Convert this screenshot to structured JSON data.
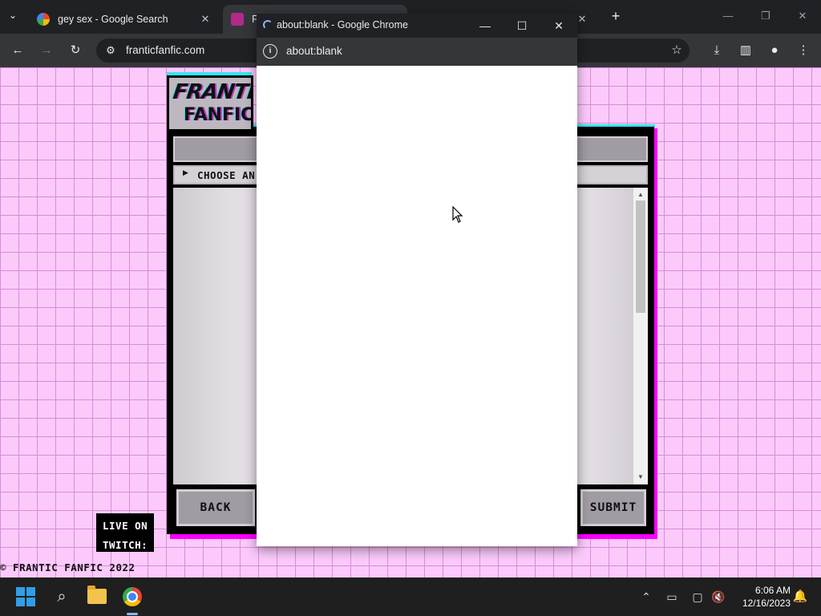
{
  "browser": {
    "tabs": [
      {
        "title": "gey sex - Google Search",
        "active": false
      },
      {
        "title": "Fr",
        "active": true
      },
      {
        "title": "",
        "active": false
      }
    ],
    "address": "franticfanfic.com"
  },
  "page": {
    "logo_line1": "FRANTIC",
    "logo_line2": "FANFIC",
    "choose_label": "CHOOSE AN",
    "back_label": "BACK",
    "submit_label": "SUBMIT",
    "live_line1": "LIVE ON",
    "live_line2": "TWITCH:",
    "copyright": "© FRANTIC FANFIC 2022"
  },
  "popup": {
    "title": "about:blank - Google Chrome",
    "address": "about:blank"
  },
  "taskbar": {
    "time": "6:06 AM",
    "date": "12/16/2023"
  },
  "colors": {
    "page_bg": "#fbcafb",
    "grid": "#d98bd9",
    "accent_magenta": "#ff00ff",
    "accent_cyan": "#33e6f0"
  }
}
